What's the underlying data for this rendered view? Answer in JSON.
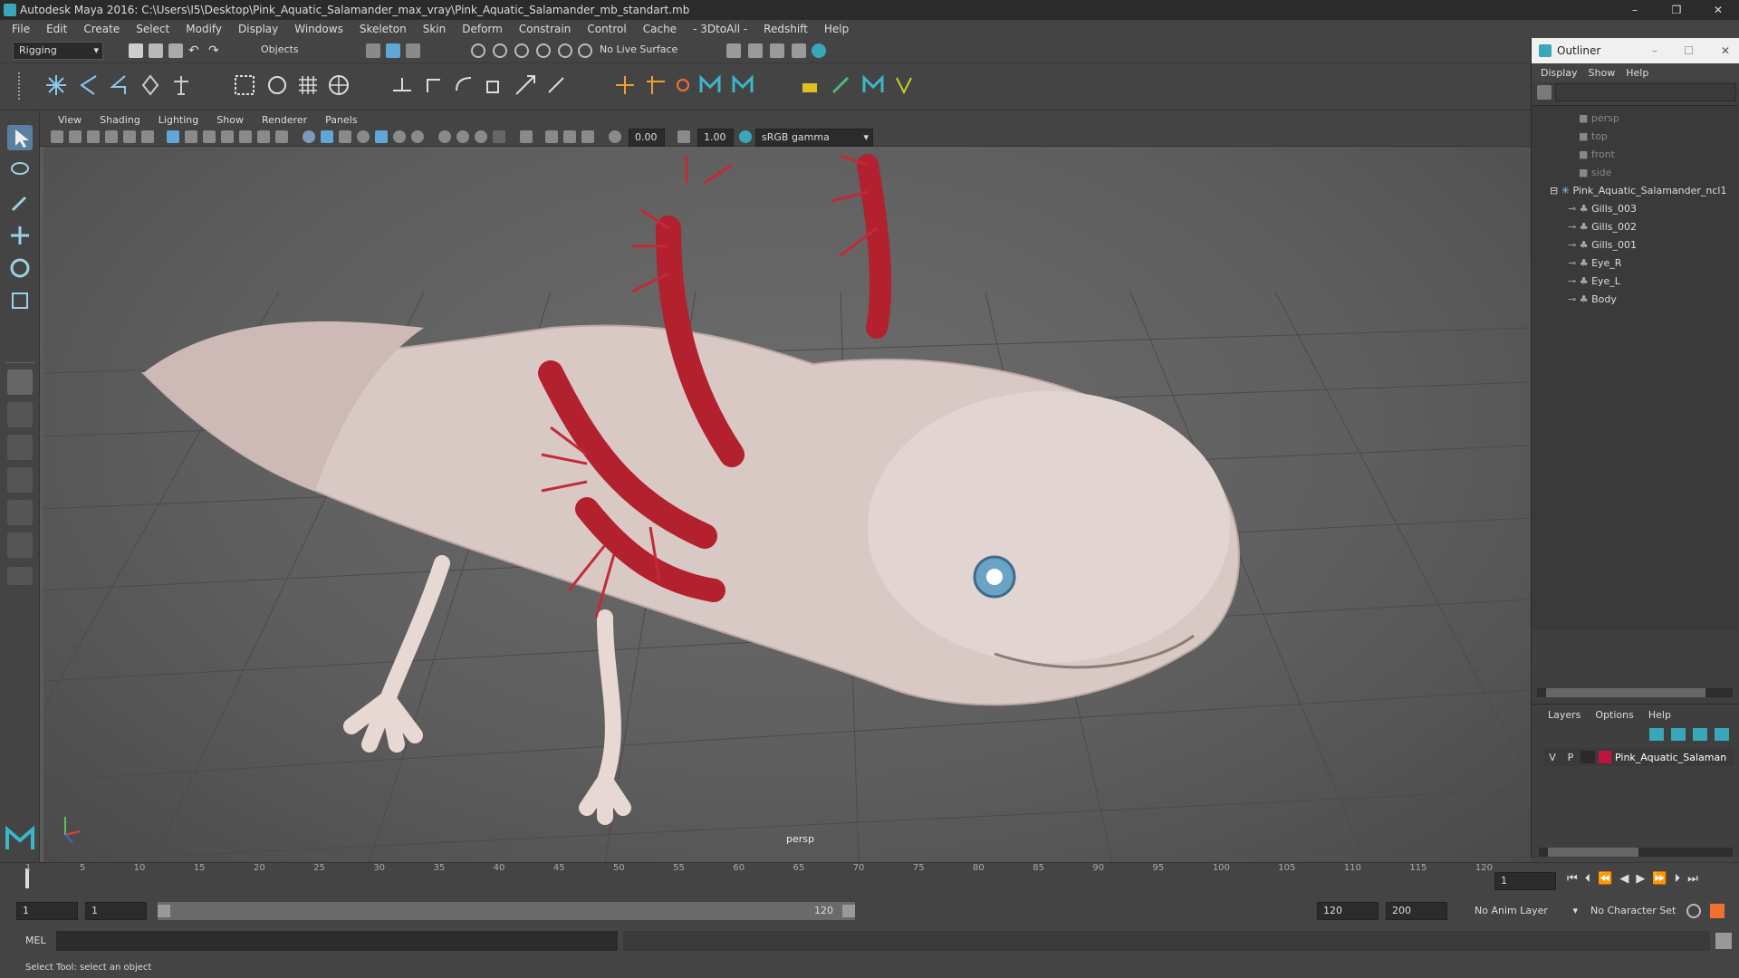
{
  "window": {
    "title": "Autodesk Maya 2016: C:\\Users\\I5\\Desktop\\Pink_Aquatic_Salamander_max_vray\\Pink_Aquatic_Salamander_mb_standart.mb",
    "minimize": "–",
    "maximize": "❐",
    "close": "✕"
  },
  "menubar": [
    "File",
    "Edit",
    "Create",
    "Select",
    "Modify",
    "Display",
    "Windows",
    "Skeleton",
    "Skin",
    "Deform",
    "Constrain",
    "Control",
    "Cache",
    "- 3DtoAll -",
    "Redshift",
    "Help"
  ],
  "statusline": {
    "menuset": "Rigging",
    "selection_mode": "Objects",
    "live_surface": "No Live Surface"
  },
  "panel": {
    "menus": [
      "View",
      "Shading",
      "Lighting",
      "Show",
      "Renderer",
      "Panels"
    ],
    "near_value": "0.00",
    "far_value": "1.00",
    "color_space": "sRGB gamma",
    "camera_label": "persp"
  },
  "outliner": {
    "title": "Outliner",
    "menus": [
      "Display",
      "Show",
      "Help"
    ],
    "cameras": [
      "persp",
      "top",
      "front",
      "side"
    ],
    "root": "Pink_Aquatic_Salamander_ncl1",
    "children": [
      "Gills_003",
      "Gills_002",
      "Gills_001",
      "Eye_R",
      "Eye_L",
      "Body"
    ]
  },
  "layers": {
    "menus": [
      "Layers",
      "Options",
      "Help"
    ],
    "row": {
      "v": "V",
      "p": "P",
      "name": "Pink_Aquatic_Salaman",
      "color": "#c0143c"
    }
  },
  "timeline": {
    "ticks": [
      "1",
      "5",
      "10",
      "15",
      "20",
      "25",
      "30",
      "35",
      "40",
      "45",
      "50",
      "55",
      "60",
      "65",
      "70",
      "75",
      "80",
      "85",
      "90",
      "95",
      "100",
      "105",
      "110",
      "115",
      "120"
    ],
    "current_frame": "1"
  },
  "range": {
    "start": "1",
    "playback_start": "1",
    "slider_start": "1",
    "slider_end": "120",
    "playback_end": "120",
    "end": "200",
    "anim_layer": "No Anim Layer",
    "character_set": "No Character Set"
  },
  "cmd": {
    "label": "MEL"
  },
  "helpline": "Select Tool: select an object",
  "colors": {
    "accent": "#3aa6b9",
    "gills": "#b3202e",
    "skin": "#e6d6d2"
  }
}
